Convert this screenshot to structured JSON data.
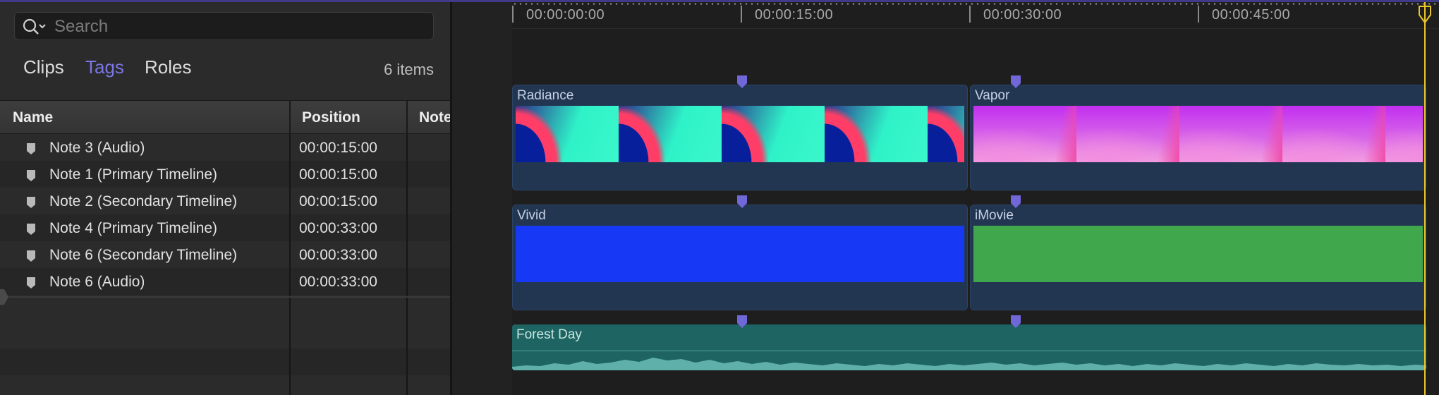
{
  "search": {
    "placeholder": "Search"
  },
  "index": {
    "tabs": [
      {
        "label": "Clips",
        "active": false
      },
      {
        "label": "Tags",
        "active": true
      },
      {
        "label": "Roles",
        "active": false
      }
    ],
    "item_count": "6 items",
    "columns": [
      "Name",
      "Position",
      "Note"
    ],
    "rows": [
      {
        "name": "Note 3 (Audio)",
        "position": "00:00:15:00"
      },
      {
        "name": "Note 1 (Primary Timeline)",
        "position": "00:00:15:00"
      },
      {
        "name": "Note 2 (Secondary Timeline)",
        "position": "00:00:15:00"
      },
      {
        "name": "Note 4 (Primary Timeline)",
        "position": "00:00:33:00"
      },
      {
        "name": "Note 6 (Secondary Timeline)",
        "position": "00:00:33:00"
      },
      {
        "name": "Note 6 (Audio)",
        "position": "00:00:33:00"
      }
    ]
  },
  "timeline": {
    "ruler": [
      "00:00:00:00",
      "00:00:15:00",
      "00:00:30:00",
      "00:00:45:00"
    ],
    "clips": {
      "radiance": "Radiance",
      "vapor": "Vapor",
      "vivid": "Vivid",
      "imovie": "iMovie",
      "forest_day": "Forest Day"
    }
  },
  "colors": {
    "accent_tab": "#7a76e4",
    "vivid_clip": "#1739f5",
    "imovie_clip": "#41a74c",
    "audio_clip": "#1e6462",
    "playhead": "#e9c62b",
    "marker": "#7068d8"
  }
}
